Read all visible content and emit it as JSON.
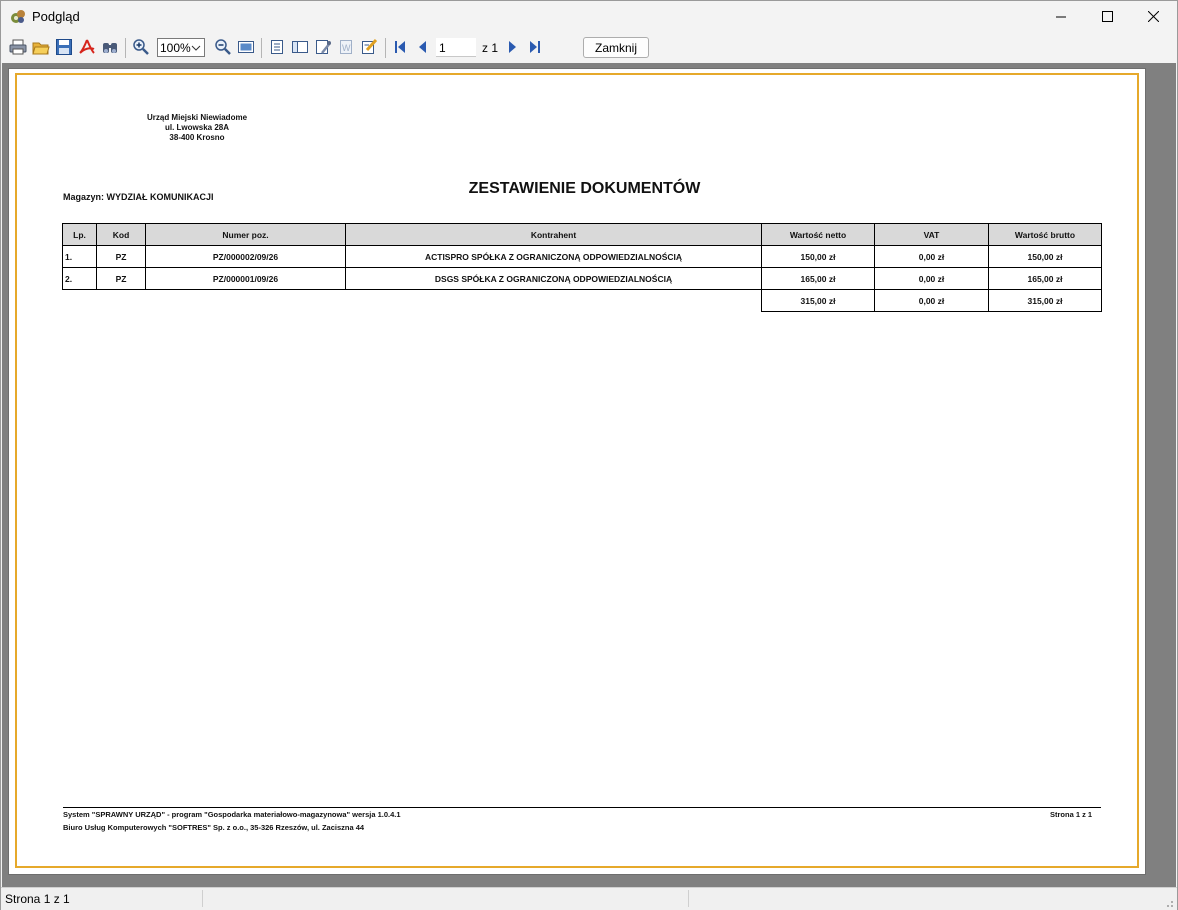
{
  "window": {
    "title": "Podgląd"
  },
  "toolbar": {
    "zoom_value": "100%",
    "page_current": "1",
    "page_of": "z 1",
    "close_label": "Zamknij",
    "icons": [
      "printer-icon",
      "open-folder-icon",
      "save-icon",
      "pdf-icon",
      "find-icon",
      "zoom-in-icon",
      "zoom-out-icon",
      "fit-page-icon",
      "single-page-icon",
      "two-pages-icon",
      "settings-icon",
      "watermark-icon",
      "edit-icon",
      "first-page-icon",
      "prev-page-icon",
      "next-page-icon",
      "last-page-icon"
    ]
  },
  "report": {
    "org_name": "Urząd Miejski Niewiadome",
    "org_street": "ul. Lwowska 28A",
    "org_city": "38-400 Krosno",
    "warehouse": "Magazyn: WYDZIAŁ KOMUNIKACJI",
    "title": "ZESTAWIENIE DOKUMENTÓW",
    "columns": [
      "Lp.",
      "Kod",
      "Numer poz.",
      "Kontrahent",
      "Wartość netto",
      "VAT",
      "Wartość brutto"
    ],
    "rows": [
      [
        "1.",
        "PZ",
        "PZ/000002/09/26",
        "ACTISPRO SPÓŁKA Z OGRANICZONĄ ODPOWIEDZIALNOŚCIĄ",
        "150,00 zł",
        "0,00 zł",
        "150,00 zł"
      ],
      [
        "2.",
        "PZ",
        "PZ/000001/09/26",
        "DSGS SPÓŁKA Z OGRANICZONĄ ODPOWIEDZIALNOŚCIĄ",
        "165,00 zł",
        "0,00 zł",
        "165,00 zł"
      ]
    ],
    "totals": {
      "netto": "315,00 zł",
      "vat": "0,00 zł",
      "brutto": "315,00 zł"
    },
    "footer_line1": "System \"SPRAWNY URZĄD\" - program \"Gospodarka materiałowo-magazynowa\" wersja 1.0.4.1",
    "footer_line2": "Biuro Usług Komputerowych \"SOFTRES\" Sp. z o.o., 35-326 Rzeszów, ul. Zaciszna 44",
    "footer_page": "Strona 1 z 1"
  },
  "statusbar": {
    "text": "Strona 1 z 1"
  },
  "colors": {
    "page_border": "#e6a92b",
    "preview_bg": "#808080",
    "header_fill": "#d9d9d9"
  }
}
